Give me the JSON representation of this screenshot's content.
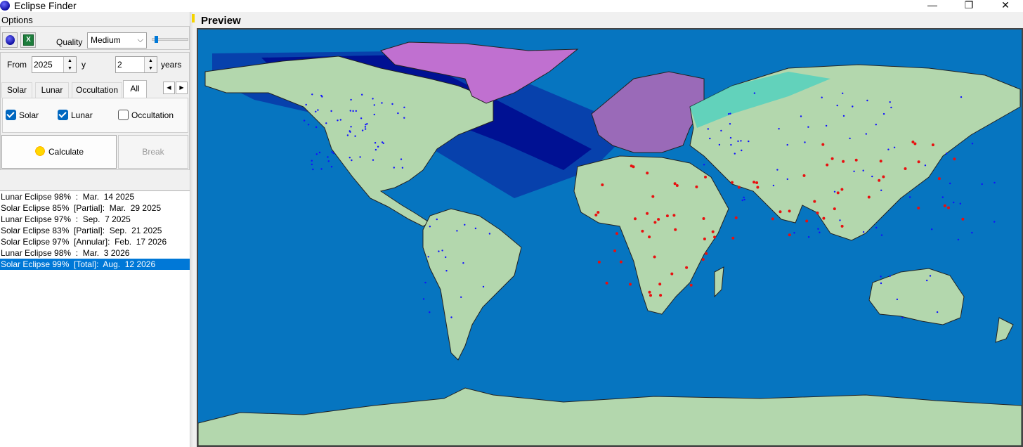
{
  "window": {
    "title": "Eclipse Finder",
    "controls": {
      "minimize": "—",
      "maximize": "❐",
      "close": "✕"
    }
  },
  "options": {
    "label": "Options",
    "quality_label": "Quality",
    "quality_value": "Medium",
    "excel_icon_letter": "X"
  },
  "range": {
    "from_label": "From",
    "from_year": "2025",
    "y_label": "y",
    "years_value": "2",
    "years_label": "years"
  },
  "tabs": [
    {
      "label": "Solar"
    },
    {
      "label": "Lunar"
    },
    {
      "label": "Occultation"
    },
    {
      "label": "All"
    }
  ],
  "filters": [
    {
      "label": "Solar",
      "checked": true
    },
    {
      "label": "Lunar",
      "checked": true
    },
    {
      "label": "Occultation",
      "checked": false
    }
  ],
  "buttons": {
    "calculate": "Calculate",
    "break": "Break"
  },
  "eclipses": [
    "Lunar Eclipse 98%  :  Mar.  14 2025",
    "Solar Eclipse 85%  [Partial]:  Mar.  29 2025",
    "Lunar Eclipse 97%  :  Sep.  7 2025",
    "Solar Eclipse 83%  [Partial]:  Sep.  21 2025",
    "Solar Eclipse 97%  [Annular]:  Feb.  17 2026",
    "Lunar Eclipse 98%  :  Mar.  3 2026",
    "Solar Eclipse 99%  [Total]:  Aug.  12 2026"
  ],
  "selected_index": 6,
  "preview": {
    "label": "Preview"
  },
  "colors": {
    "ocean": "#0675c0",
    "land": "#b3d7ad",
    "city_major": "#e81010",
    "city_minor": "#1010ff",
    "selection": "#0078d7"
  }
}
